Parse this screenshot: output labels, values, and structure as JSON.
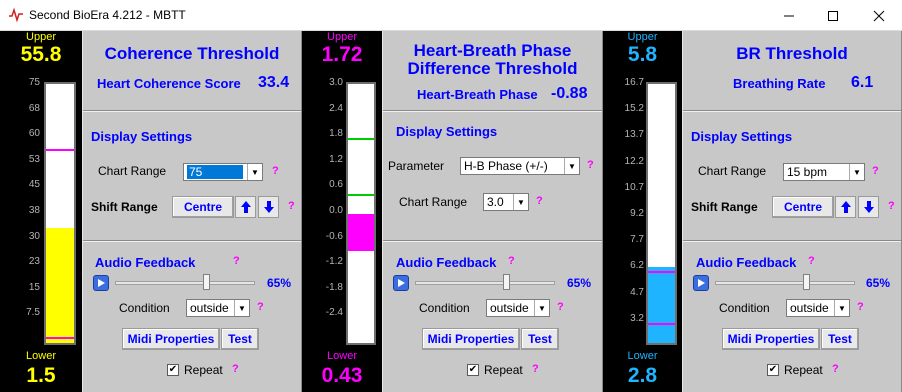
{
  "window": {
    "title": "Second BioEra 4.212 - MBTT"
  },
  "meters": [
    {
      "upper_label": "Upper",
      "upper_value": "55.8",
      "lower_label": "Lower",
      "lower_value": "1.5",
      "color": "#ffff00",
      "label_color": "#ffff00",
      "ticks": [
        "75",
        "68",
        "60",
        "53",
        "45",
        "38",
        "30",
        "23",
        "15",
        "7.5"
      ],
      "scale_min": 0,
      "scale_max": 75,
      "fill_from": 0,
      "fill_to": 33.4,
      "markers": [
        55.8,
        1.5
      ],
      "marker_color": "#ff00ff"
    },
    {
      "upper_label": "Upper",
      "upper_value": "1.72",
      "lower_label": "Lower",
      "lower_value": "0.43",
      "color": "#ff00ff",
      "label_color": "#ff00ff",
      "ticks": [
        "3.0",
        "2.4",
        "1.8",
        "1.2",
        "0.6",
        "0.0",
        "-0.6",
        "-1.2",
        "-1.8",
        "-2.4"
      ],
      "scale_min": -3.0,
      "scale_max": 3.0,
      "fill_from": -0.88,
      "fill_to": 0.0,
      "markers": [
        1.72,
        0.43
      ],
      "marker_color": "#00cc00"
    },
    {
      "upper_label": "Upper",
      "upper_value": "5.8",
      "lower_label": "Lower",
      "lower_value": "2.8",
      "color": "#1eb4ff",
      "label_color": "#1eb4ff",
      "ticks": [
        "16.7",
        "15.2",
        "13.7",
        "12.2",
        "10.7",
        "9.2",
        "7.7",
        "6.2",
        "4.7",
        "3.2"
      ],
      "scale_min": 1.7,
      "scale_max": 16.7,
      "fill_from": 1.7,
      "fill_to": 6.1,
      "markers": [
        5.8,
        2.8
      ],
      "marker_color": "#ff00ff"
    }
  ],
  "panels": [
    {
      "title_line1": "Coherence Threshold",
      "title_line2": "",
      "metric_label": "Heart Coherence Score",
      "metric_value": "33.4",
      "display_settings": "Display Settings",
      "parameter_label": "",
      "parameter_value": "",
      "chart_range_label": "Chart Range",
      "chart_range_value": "75",
      "shift_range_label": "Shift Range",
      "centre_label": "Centre",
      "audio_feedback": "Audio Feedback",
      "volume": "65%",
      "condition_label": "Condition",
      "condition_value": "outside",
      "midi_label": "Midi Properties",
      "test_label": "Test",
      "repeat_label": "Repeat",
      "help": "?"
    },
    {
      "title_line1": "Heart-Breath Phase",
      "title_line2": "Difference Threshold",
      "metric_label": "Heart-Breath Phase",
      "metric_value": "-0.88",
      "display_settings": "Display Settings",
      "parameter_label": "Parameter",
      "parameter_value": "H-B Phase (+/-)",
      "chart_range_label": "Chart Range",
      "chart_range_value": "3.0",
      "shift_range_label": "",
      "centre_label": "",
      "audio_feedback": "Audio Feedback",
      "volume": "65%",
      "condition_label": "Condition",
      "condition_value": "outside",
      "midi_label": "Midi Properties",
      "test_label": "Test",
      "repeat_label": "Repeat",
      "help": "?"
    },
    {
      "title_line1": "BR Threshold",
      "title_line2": "",
      "metric_label": "Breathing Rate",
      "metric_value": "6.1",
      "display_settings": "Display Settings",
      "parameter_label": "",
      "parameter_value": "",
      "chart_range_label": "Chart Range",
      "chart_range_value": "15 bpm",
      "shift_range_label": "Shift Range",
      "centre_label": "Centre",
      "audio_feedback": "Audio Feedback",
      "volume": "65%",
      "condition_label": "Condition",
      "condition_value": "outside",
      "midi_label": "Midi Properties",
      "test_label": "Test",
      "repeat_label": "Repeat",
      "help": "?"
    }
  ],
  "icons": [
    "app-icon",
    "minimize-icon",
    "maximize-icon",
    "close-icon",
    "play-icon",
    "arrow-up-icon",
    "arrow-down-icon",
    "dropdown-arrow-icon",
    "checkmark-icon"
  ]
}
